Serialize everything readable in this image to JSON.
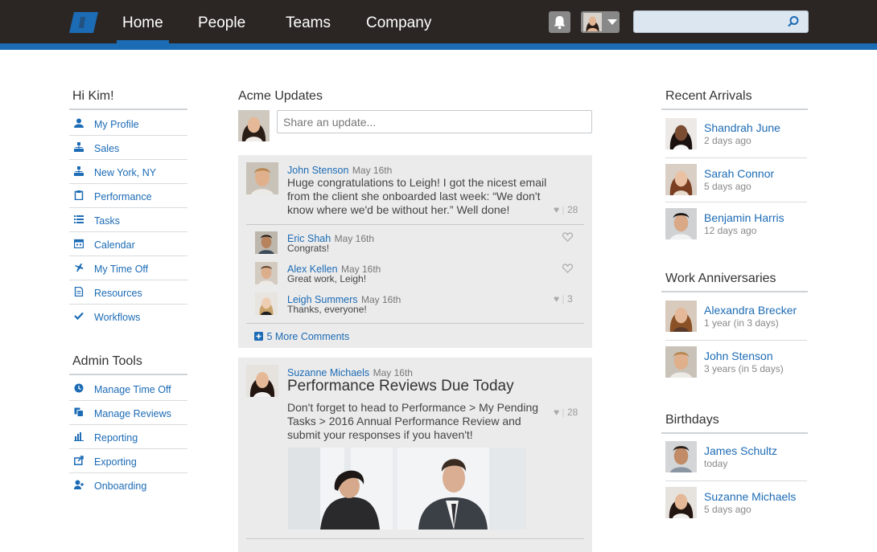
{
  "nav": {
    "tabs": [
      {
        "label": "Home"
      },
      {
        "label": "People"
      },
      {
        "label": "Teams"
      },
      {
        "label": "Company"
      }
    ],
    "search_placeholder": ""
  },
  "sidebar": {
    "greeting": "Hi Kim!",
    "items": [
      {
        "label": "My Profile",
        "icon": "person-icon"
      },
      {
        "label": "Sales",
        "icon": "org-chart-icon"
      },
      {
        "label": "New York, NY",
        "icon": "org-chart-icon"
      },
      {
        "label": "Performance",
        "icon": "clipboard-icon"
      },
      {
        "label": "Tasks",
        "icon": "list-icon"
      },
      {
        "label": "Calendar",
        "icon": "calendar-icon"
      },
      {
        "label": "My Time Off",
        "icon": "airplane-icon"
      },
      {
        "label": "Resources",
        "icon": "document-icon"
      },
      {
        "label": "Workflows",
        "icon": "checkmark-icon"
      }
    ],
    "admin_title": "Admin Tools",
    "admin_items": [
      {
        "label": "Manage Time Off",
        "icon": "clock-icon"
      },
      {
        "label": "Manage Reviews",
        "icon": "copy-icon"
      },
      {
        "label": "Reporting",
        "icon": "bar-chart-icon"
      },
      {
        "label": "Exporting",
        "icon": "export-icon"
      },
      {
        "label": "Onboarding",
        "icon": "add-person-icon"
      }
    ]
  },
  "feed": {
    "title": "Acme Updates",
    "share_placeholder": "Share an update...",
    "post1": {
      "author": "John Stenson",
      "date": "May 16th",
      "text": "Huge congratulations to Leigh! I got the nicest email from the client she onboarded last week: “We don't know where we'd be without her.” Well done!",
      "likes": "28",
      "comments": [
        {
          "author": "Eric Shah",
          "date": "May 16th",
          "text": "Congrats!",
          "likes": ""
        },
        {
          "author": "Alex Kellen",
          "date": "May 16th",
          "text": "Great work, Leigh!",
          "likes": ""
        },
        {
          "author": "Leigh Summers",
          "date": "May 16th",
          "text": "Thanks, everyone!",
          "likes": "3"
        }
      ],
      "more_comments": "5 More Comments"
    },
    "post2": {
      "author": "Suzanne Michaels",
      "date": "May 16th",
      "title": "Performance Reviews Due Today",
      "text": "Don't forget to head to Performance > My Pending Tasks > 2016 Annual Performance Review and submit your responses if you haven't!",
      "likes": "28"
    }
  },
  "right": {
    "arrivals_title": "Recent Arrivals",
    "arrivals": [
      {
        "name": "Shandrah June",
        "sub": "2 days ago"
      },
      {
        "name": "Sarah Connor",
        "sub": "5 days ago"
      },
      {
        "name": "Benjamin Harris",
        "sub": "12 days ago"
      }
    ],
    "anniv_title": "Work Anniversaries",
    "anniv": [
      {
        "name": "Alexandra Brecker",
        "sub": "1 year (in 3 days)"
      },
      {
        "name": "John Stenson",
        "sub": "3 years (in 5 days)"
      }
    ],
    "bday_title": "Birthdays",
    "bdays": [
      {
        "name": "James Schultz",
        "sub": "today"
      },
      {
        "name": "Suzanne Michaels",
        "sub": "5 days ago"
      }
    ]
  },
  "colors": {
    "accent": "#1c6bb5",
    "topbar": "#2b2623",
    "card": "#ebebeb"
  }
}
